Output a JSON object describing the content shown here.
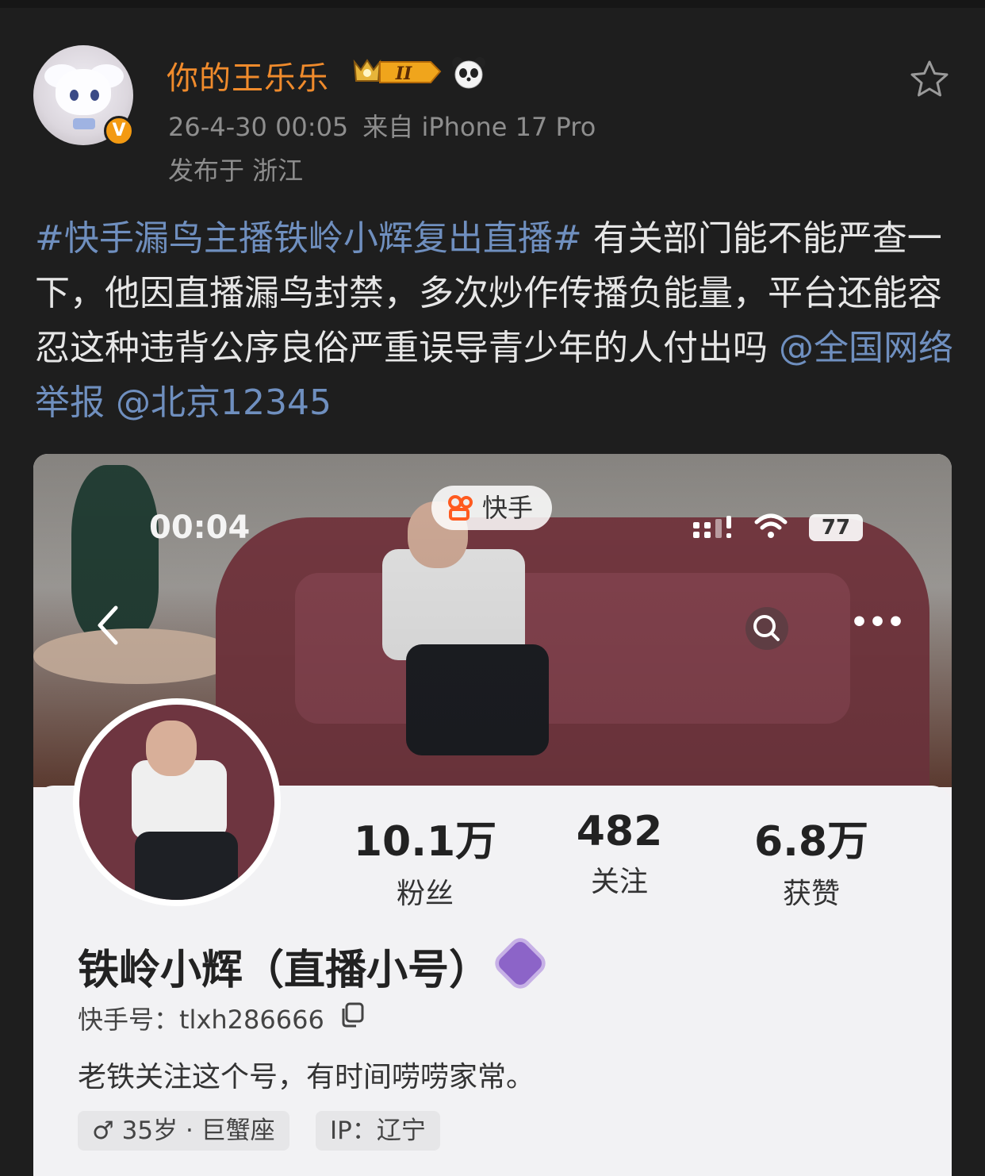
{
  "post": {
    "username": "你的王乐乐",
    "level_badge": "II",
    "timestamp": "26-4-30 00:05",
    "source": "来自 iPhone 17 Pro",
    "location": "发布于 浙江",
    "hashtag": "#快手漏鸟主播铁岭小辉复出直播#",
    "text": " 有关部门能不能严查一下，他因直播漏鸟封禁，多次炒作传播负能量，平台还能容忍这种违背公序良俗严重误导青少年的人付出吗 ",
    "mention_1": "@全国网络举报",
    "mention_2": "@北京12345",
    "icons": [
      "verified-v-icon",
      "crown-level-icon",
      "panda-icon",
      "favorite-star-icon"
    ],
    "colors": {
      "username": "#f08b2c",
      "link": "#6f8fbf",
      "background": "#1e1e1e"
    }
  },
  "screenshot": {
    "status_time": "00:04",
    "app_label": "快手",
    "battery": "77",
    "stats": [
      {
        "value": "10.1万",
        "label": "粉丝"
      },
      {
        "value": "482",
        "label": "关注"
      },
      {
        "value": "6.8万",
        "label": "获赞"
      }
    ],
    "profile_name": "铁岭小辉（直播小号）",
    "kuaishou_id": "快手号：tlxh286666",
    "bio": "老铁关注这个号，有时间唠唠家常。",
    "tags": [
      "♂ 35岁 · 巨蟹座",
      "IP：辽宁"
    ]
  }
}
